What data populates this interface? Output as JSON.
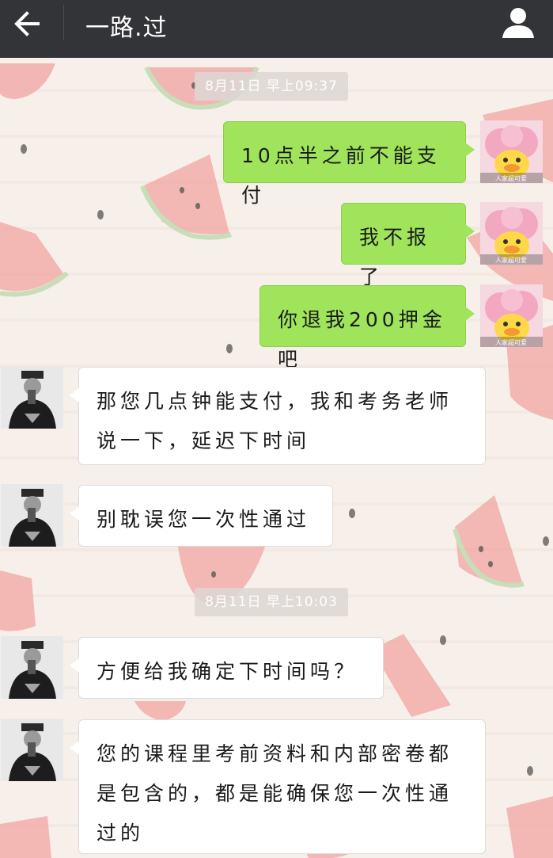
{
  "header": {
    "title": "一路.过",
    "back_icon": "arrow-left-icon",
    "profile_icon": "person-icon",
    "background_color": "#333437"
  },
  "timestamps": [
    {
      "label": "8月11日 早上09:37"
    },
    {
      "label": "8月11日 早上10:03"
    }
  ],
  "messages": [
    {
      "side": "right",
      "lines": [
        "10点半之前不能支付"
      ]
    },
    {
      "side": "right",
      "lines": [
        "我不报了"
      ]
    },
    {
      "side": "right",
      "lines": [
        "你退我200押金吧"
      ]
    },
    {
      "side": "left",
      "lines": [
        "那您几点钟能支付，我和考务老师",
        "说一下，延迟下时间"
      ]
    },
    {
      "side": "left",
      "lines": [
        "别耽误您一次性通过"
      ]
    },
    {
      "side": "left",
      "lines": [
        "方便给我确定下时间吗？"
      ]
    },
    {
      "side": "left",
      "lines": [
        "您的课程里考前资料和内部密卷都",
        "是包含的，都是能确保您一次性通",
        "过的"
      ]
    }
  ],
  "self_avatar": {
    "caption": "人家超可爱"
  },
  "colors": {
    "sent_bubble": "#9fe45a",
    "received_bubble": "#ffffff",
    "timestamp_bg": "#dcd7d4"
  }
}
